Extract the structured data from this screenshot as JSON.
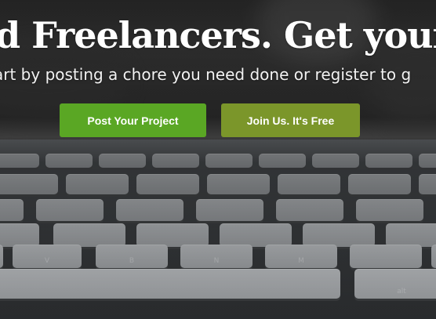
{
  "hero": {
    "headline": "d Freelancers. Get your proj",
    "subline": "art by posting a chore you need done or register to g",
    "buttons": {
      "post_project": "Post Your Project",
      "join_us": "Join Us. It's Free"
    },
    "colors": {
      "post_button": "#5aa724",
      "join_button": "#7b962a",
      "text": "#ffffff"
    }
  },
  "keyboard": {
    "key_legends": [
      "V",
      "B",
      "N",
      "M",
      "alt"
    ]
  }
}
